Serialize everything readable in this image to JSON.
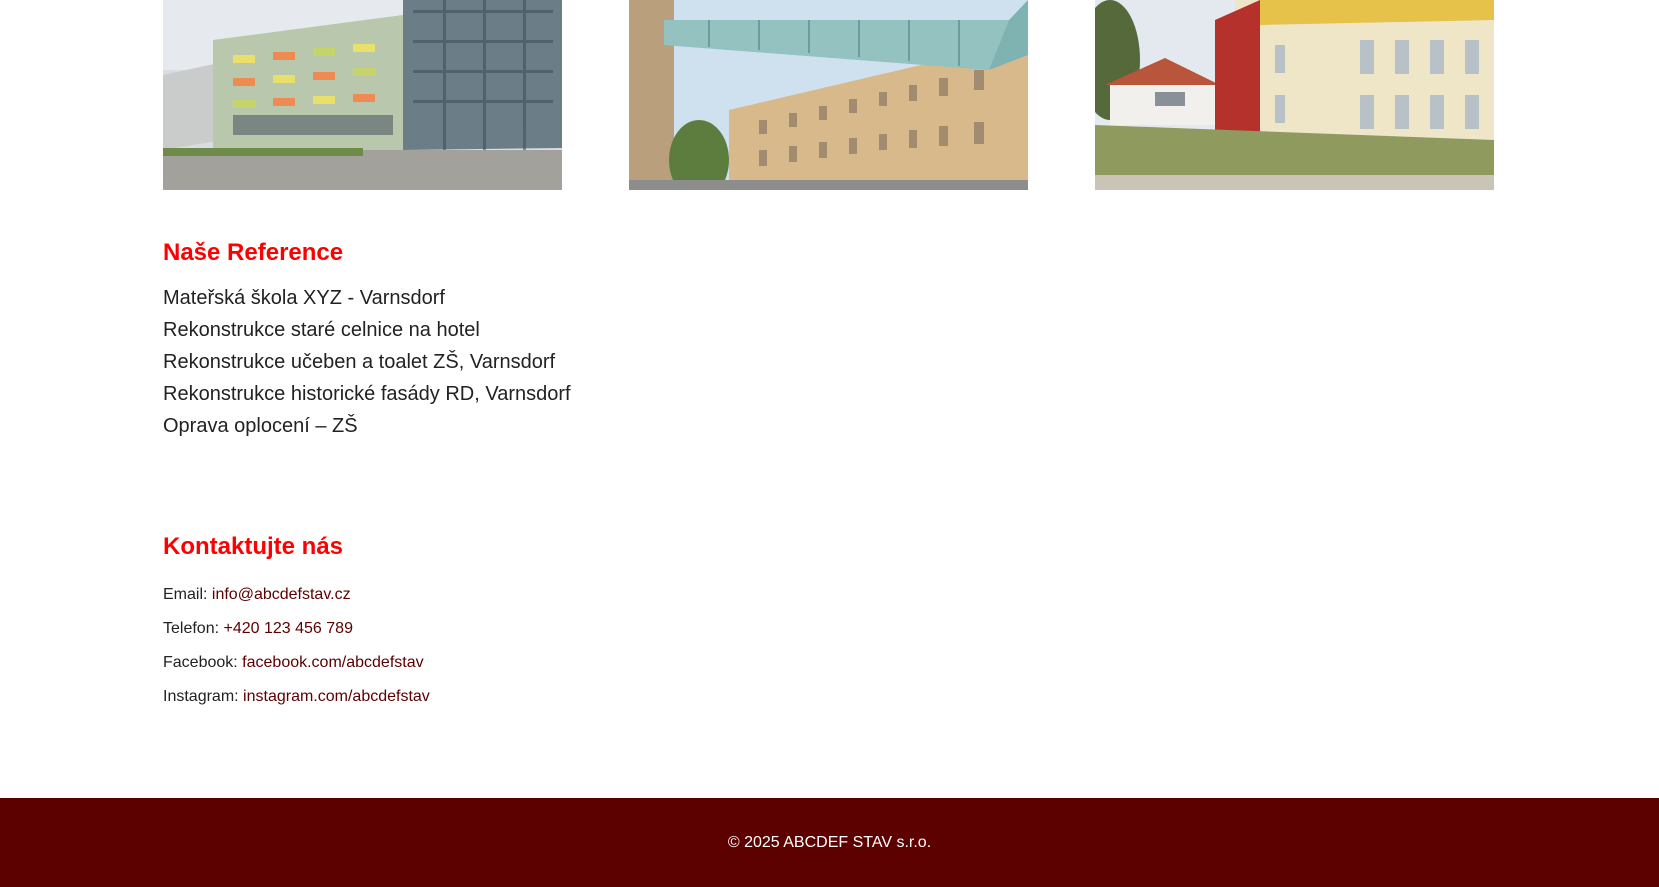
{
  "gallery": {
    "photos": [
      {
        "icon": "building-photo-modern-school"
      },
      {
        "icon": "building-photo-glass-bridge"
      },
      {
        "icon": "building-photo-red-yellow-facade"
      }
    ]
  },
  "references": {
    "title": "Naše Reference",
    "items": [
      "Mateřská škola XYZ - Varnsdorf",
      "Rekonstrukce staré celnice na hotel",
      "Rekonstrukce učeben a toalet ZŠ, Varnsdorf",
      "Rekonstrukce historické fasády RD, Varnsdorf",
      "Oprava oplocení – ZŠ"
    ]
  },
  "contact": {
    "title": "Kontaktujte nás",
    "email_label": "Email:",
    "email_value": "info@abcdefstav.cz",
    "phone_label": "Telefon:",
    "phone_value": "+420 123 456 789",
    "facebook_label": "Facebook:",
    "facebook_value": "facebook.com/abcdefstav",
    "instagram_label": "Instagram:",
    "instagram_value": "instagram.com/abcdefstav"
  },
  "footer": {
    "copyright": "© 2025 ABCDEF STAV s.r.o."
  },
  "colors": {
    "accent": "#ff0000",
    "footer_bg": "#5c0000",
    "link": "#5c0000",
    "text": "#222222"
  }
}
